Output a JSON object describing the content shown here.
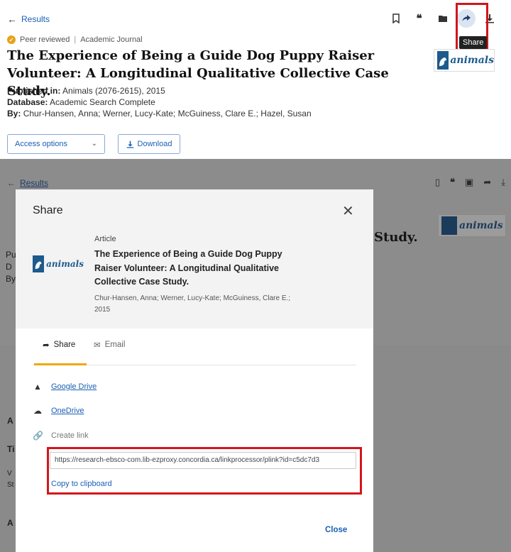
{
  "top": {
    "results_link": "Results",
    "meta_peer": "Peer reviewed",
    "meta_type": "Academic Journal",
    "title": "The Experience of Being a Guide Dog Puppy Raiser Volunteer: A Longitudinal Qualitative Collective Case Study.",
    "published_label": "Published in:",
    "published_value": "Animals (2076-2615), 2015",
    "database_label": "Database:",
    "database_value": "Academic Search Complete",
    "by_label": "By:",
    "by_value": "Chur-Hansen, Anna; Werner, Lucy-Kate; McGuiness, Clare E.; Hazel, Susan",
    "access_button": "Access options",
    "download_button": "Download",
    "tooltip": "Share",
    "logo_text": "animals"
  },
  "background": {
    "results_link": "Results",
    "study_fragment": "Study.",
    "logo_text": "animals",
    "letters": [
      "Pu",
      "D",
      "By",
      "A",
      "Ti",
      "V",
      "St",
      "A"
    ]
  },
  "modal": {
    "title": "Share",
    "article_type": "Article",
    "article_title": "The Experience of Being a Guide Dog Puppy Raiser Volunteer: A Longitudinal Qualitative Collective Case Study.",
    "article_authors": "Chur-Hansen, Anna; Werner, Lucy-Kate; McGuiness, Clare E.; 2015",
    "logo_text": "animals",
    "tabs": [
      {
        "label": "Share"
      },
      {
        "label": "Email"
      }
    ],
    "options": [
      {
        "label": "Google Drive"
      },
      {
        "label": "OneDrive"
      },
      {
        "label": "Create link"
      }
    ],
    "link_value": "https://research-ebsco-com.lib-ezproxy.concordia.ca/linkprocessor/plink?id=c5dc7d3",
    "copy_label": "Copy to clipboard",
    "close_label": "Close"
  },
  "colors": {
    "accent": "#1a5fb4",
    "highlight": "#d3151b",
    "tab_underline": "#f0a800",
    "overlay": "#8c8c8c"
  }
}
